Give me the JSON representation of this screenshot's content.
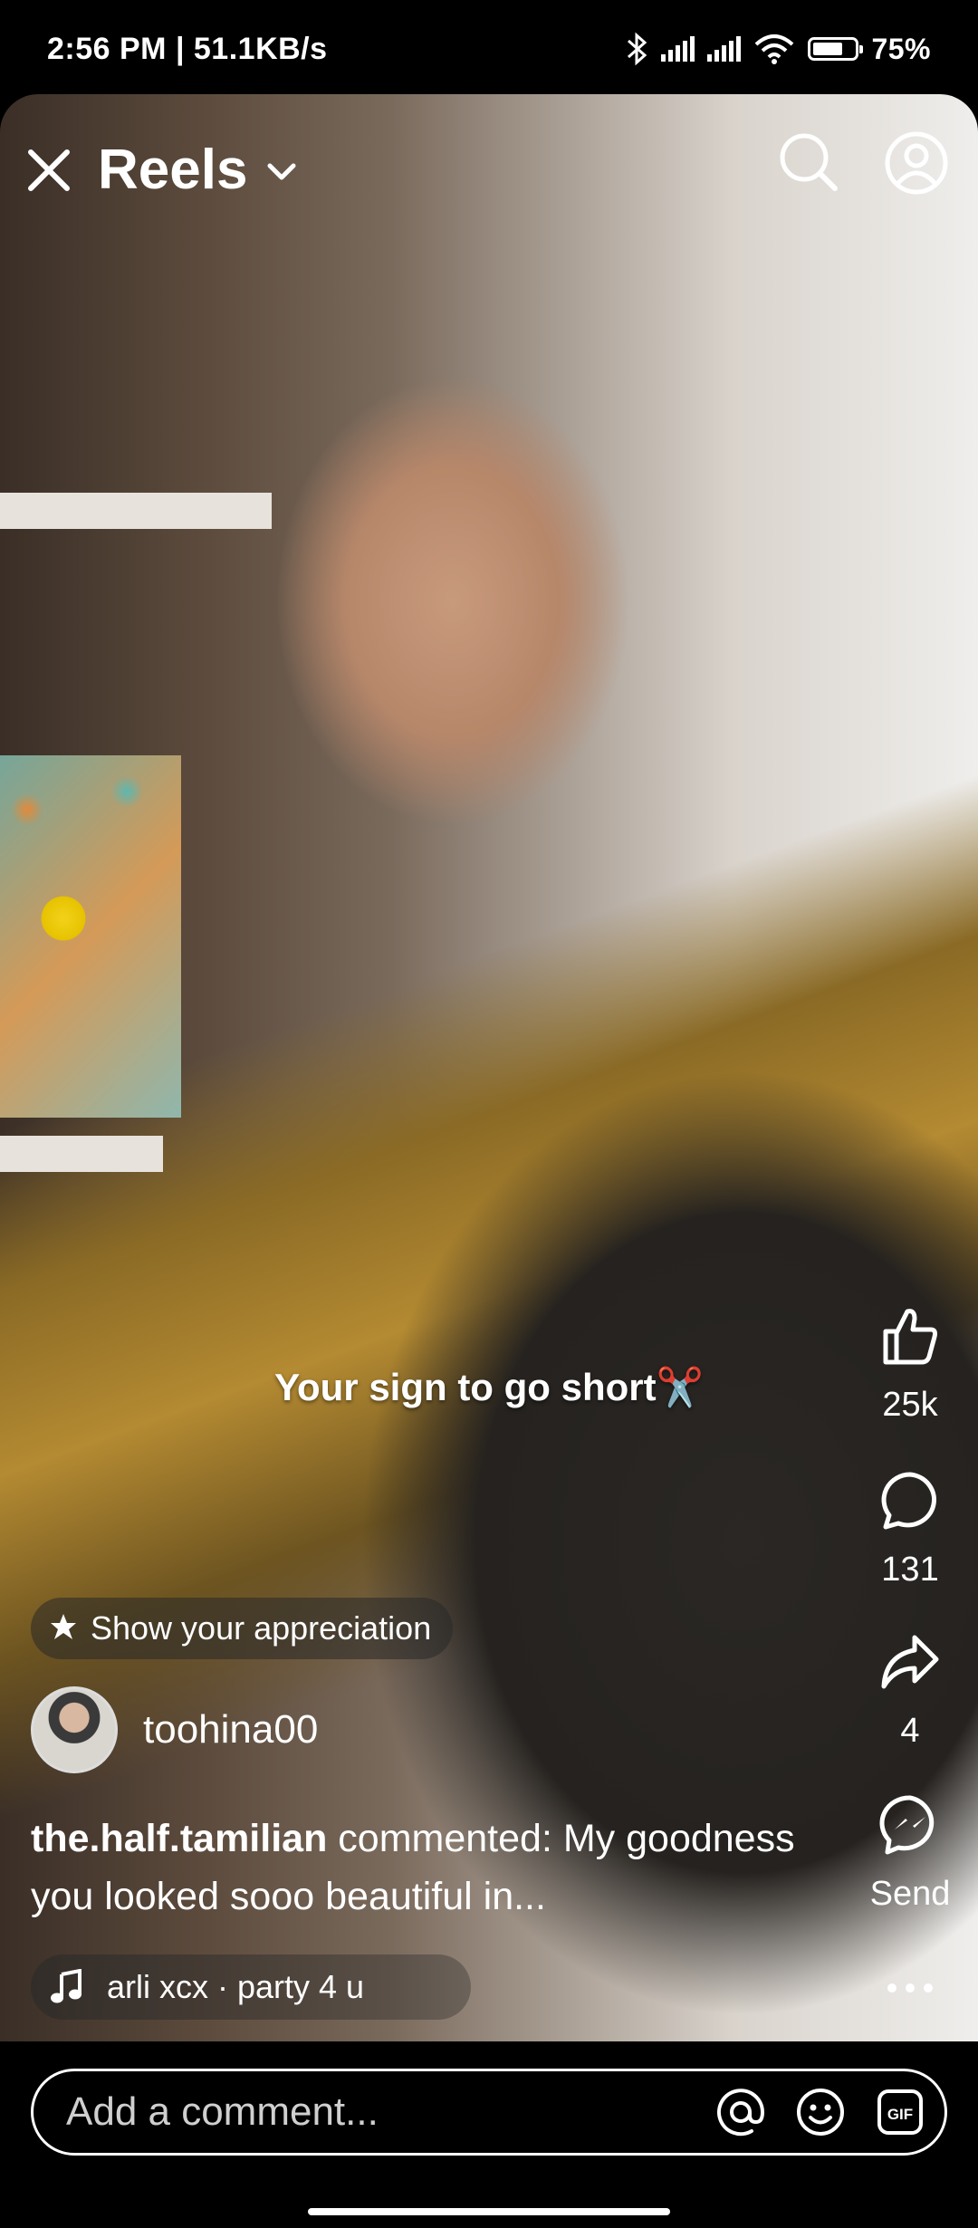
{
  "status_bar": {
    "time_speed": "2:56 PM | 51.1KB/s",
    "battery": "75%",
    "battery_level": 0.75
  },
  "header": {
    "title": "Reels"
  },
  "video": {
    "overlay_text": "Your sign to go short✂️"
  },
  "actions": {
    "likes": "25k",
    "comments": "131",
    "shares": "4",
    "send_label": "Send"
  },
  "appreciation": {
    "label": "Show your appreciation"
  },
  "author": {
    "username": "toohina00"
  },
  "comment_preview": {
    "commenter": "the.half.tamilian",
    "text": " commented: My goodness you looked sooo beautiful in..."
  },
  "music": {
    "track": "arli xcx · party 4 u"
  },
  "comment_bar": {
    "placeholder": "Add a comment..."
  }
}
